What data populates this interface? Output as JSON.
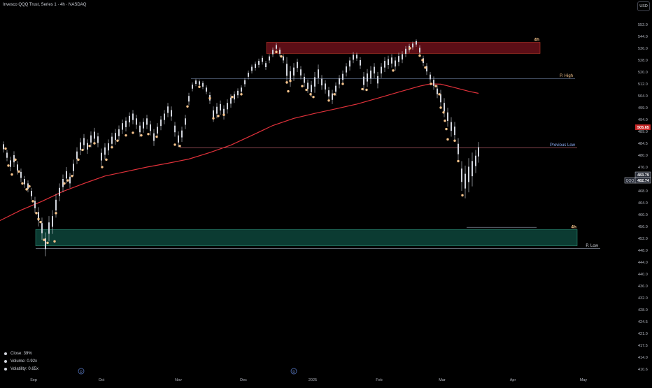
{
  "header": {
    "title": "Invesco QQQ Trust, Series 1 · 4h · NASDAQ",
    "currency": "USD"
  },
  "stats": [
    {
      "label": "Close: 39%"
    },
    {
      "label": "Volume: 0.92x"
    },
    {
      "label": "Volatility: 0.65x"
    }
  ],
  "colors": {
    "background": "#000000",
    "candle": "#d1d4dc",
    "ma_line": "#e0313a",
    "marker": "#f7c48c",
    "resistance_zone": "#5c0e16",
    "support_zone": "#0b3b32",
    "level_line": "#5b6b8a",
    "axis_text": "#b2b5be"
  },
  "chart_data": {
    "type": "candlestick",
    "symbol": "QQQ",
    "price_axis": {
      "ticks": [
        410.6,
        414.0,
        417.5,
        421.0,
        424.5,
        428.0,
        432.0,
        436.0,
        440.0,
        444.0,
        448.0,
        452.0,
        456.0,
        460.0,
        464.0,
        468.0,
        472.0,
        476.0,
        480.0,
        484.5,
        489.0,
        494.0,
        499.0,
        504.0,
        512.0,
        520.0,
        528.0,
        536.0,
        544.0,
        552.0
      ],
      "scale": "log"
    },
    "time_axis": {
      "labels": [
        "Sep",
        "Oct",
        "Nov",
        "Dec",
        "2025",
        "Feb",
        "Mar",
        "Apr",
        "May"
      ]
    },
    "event_markers": [
      "D",
      "D"
    ],
    "price_tags": [
      {
        "label": "505.65",
        "value": 505.65,
        "color": "#e0313a"
      },
      {
        "label": "483.79",
        "value": 483.79,
        "color": "#d1d4dc"
      },
      {
        "label": "482.74",
        "value": 482.74,
        "color": "#d1d4dc",
        "prefix": "QQQ"
      }
    ],
    "levels": [
      {
        "label": "P. High",
        "value": 515.5
      },
      {
        "label": "Previous Low",
        "value": 482.8
      },
      {
        "label": "P. Low",
        "value": 448.6
      }
    ],
    "zones": [
      {
        "label": "4h",
        "kind": "resistance",
        "top": 540.0,
        "bottom": 532.5
      },
      {
        "label": "4h",
        "kind": "support",
        "top": 455.0,
        "bottom": 449.5
      }
    ],
    "ma_series": [
      [
        0,
        458.0
      ],
      [
        30,
        461.5
      ],
      [
        60,
        464.5
      ],
      [
        90,
        467.8
      ],
      [
        120,
        470.5
      ],
      [
        150,
        473.0
      ],
      [
        180,
        474.5
      ],
      [
        210,
        476.0
      ],
      [
        240,
        477.3
      ],
      [
        270,
        478.7
      ],
      [
        300,
        481.0
      ],
      [
        330,
        483.8
      ],
      [
        360,
        487.5
      ],
      [
        390,
        491.5
      ],
      [
        420,
        494.5
      ],
      [
        450,
        496.6
      ],
      [
        480,
        498.5
      ],
      [
        510,
        500.5
      ],
      [
        540,
        503.0
      ],
      [
        570,
        506.5
      ],
      [
        600,
        510.5
      ],
      [
        615,
        512.0
      ],
      [
        630,
        511.8
      ],
      [
        650,
        509.5
      ],
      [
        670,
        507.0
      ],
      [
        684,
        505.65
      ]
    ],
    "candles": [
      [
        5,
        481.0,
        485.2
      ],
      [
        10,
        478.0,
        482.0
      ],
      [
        15,
        474.6,
        479.5
      ],
      [
        20,
        476.0,
        481.5
      ],
      [
        25,
        473.5,
        478.0
      ],
      [
        30,
        471.0,
        475.5
      ],
      [
        35,
        469.0,
        473.0
      ],
      [
        40,
        467.5,
        471.5
      ],
      [
        45,
        465.0,
        469.0
      ],
      [
        50,
        460.5,
        466.0
      ],
      [
        55,
        456.0,
        462.5
      ],
      [
        60,
        451.5,
        459.0
      ],
      [
        65,
        446.0,
        454.0
      ],
      [
        70,
        451.0,
        459.5
      ],
      [
        75,
        453.5,
        461.5
      ],
      [
        80,
        459.0,
        467.0
      ],
      [
        85,
        464.5,
        470.5
      ],
      [
        90,
        467.5,
        473.5
      ],
      [
        95,
        470.5,
        476.0
      ],
      [
        100,
        469.0,
        474.0
      ],
      [
        105,
        473.0,
        478.5
      ],
      [
        110,
        477.0,
        483.0
      ],
      [
        115,
        480.0,
        486.5
      ],
      [
        120,
        482.0,
        488.0
      ],
      [
        125,
        480.5,
        486.0
      ],
      [
        130,
        483.0,
        489.0
      ],
      [
        135,
        484.5,
        490.5
      ],
      [
        140,
        483.0,
        488.5
      ],
      [
        145,
        476.5,
        482.5
      ],
      [
        150,
        478.5,
        484.5
      ],
      [
        155,
        480.0,
        486.0
      ],
      [
        160,
        482.5,
        488.5
      ],
      [
        165,
        484.0,
        490.0
      ],
      [
        170,
        485.5,
        491.5
      ],
      [
        175,
        488.0,
        494.0
      ],
      [
        180,
        489.0,
        495.0
      ],
      [
        185,
        491.0,
        497.0
      ],
      [
        190,
        492.0,
        498.0
      ],
      [
        195,
        490.0,
        496.0
      ],
      [
        200,
        487.0,
        493.0
      ],
      [
        205,
        488.5,
        494.5
      ],
      [
        210,
        490.0,
        496.0
      ],
      [
        215,
        487.5,
        493.5
      ],
      [
        220,
        483.5,
        490.0
      ],
      [
        225,
        486.5,
        492.5
      ],
      [
        230,
        489.5,
        495.5
      ],
      [
        235,
        492.0,
        498.0
      ],
      [
        240,
        495.0,
        501.0
      ],
      [
        245,
        493.5,
        499.5
      ],
      [
        250,
        487.0,
        493.0
      ],
      [
        255,
        483.0,
        489.0
      ],
      [
        260,
        485.0,
        491.0
      ],
      [
        265,
        490.0,
        496.0
      ],
      [
        270,
        500.0,
        506.0
      ],
      [
        275,
        507.0,
        513.0
      ],
      [
        280,
        510.5,
        515.5
      ],
      [
        285,
        510.0,
        515.0
      ],
      [
        290,
        508.5,
        514.0
      ],
      [
        295,
        505.0,
        511.0
      ],
      [
        300,
        500.5,
        506.5
      ],
      [
        305,
        493.0,
        499.5
      ],
      [
        310,
        494.5,
        501.0
      ],
      [
        315,
        496.0,
        502.0
      ],
      [
        320,
        494.0,
        500.0
      ],
      [
        325,
        496.5,
        502.5
      ],
      [
        330,
        499.0,
        505.0
      ],
      [
        335,
        501.0,
        507.0
      ],
      [
        340,
        503.0,
        509.0
      ],
      [
        345,
        505.0,
        511.0
      ],
      [
        350,
        510.0,
        516.0
      ],
      [
        355,
        515.0,
        521.0
      ],
      [
        360,
        519.0,
        525.0
      ],
      [
        365,
        521.0,
        527.0
      ],
      [
        370,
        523.0,
        529.0
      ],
      [
        375,
        525.0,
        531.0
      ],
      [
        380,
        521.5,
        527.5
      ],
      [
        385,
        526.0,
        532.0
      ],
      [
        390,
        530.0,
        536.5
      ],
      [
        395,
        534.0,
        539.5
      ],
      [
        400,
        530.5,
        536.5
      ],
      [
        405,
        526.0,
        532.0
      ],
      [
        410,
        512.0,
        530.0
      ],
      [
        415,
        510.0,
        524.0
      ],
      [
        420,
        514.0,
        526.0
      ],
      [
        425,
        520.0,
        529.0
      ],
      [
        430,
        515.0,
        524.0
      ],
      [
        435,
        510.0,
        519.0
      ],
      [
        440,
        506.0,
        515.0
      ],
      [
        445,
        503.5,
        514.0
      ],
      [
        450,
        506.0,
        520.0
      ],
      [
        455,
        512.0,
        525.0
      ],
      [
        460,
        508.0,
        518.0
      ],
      [
        465,
        505.5,
        514.5
      ],
      [
        470,
        502.0,
        510.0
      ],
      [
        475,
        500.5,
        508.0
      ],
      [
        480,
        504.0,
        513.0
      ],
      [
        485,
        509.0,
        518.0
      ],
      [
        490,
        512.0,
        521.0
      ],
      [
        495,
        517.0,
        526.0
      ],
      [
        500,
        521.0,
        530.0
      ],
      [
        505,
        526.0,
        533.5
      ],
      [
        510,
        527.5,
        533.0
      ],
      [
        515,
        522.0,
        530.0
      ],
      [
        520,
        507.5,
        520.0
      ],
      [
        525,
        510.0,
        522.0
      ],
      [
        530,
        512.0,
        524.0
      ],
      [
        535,
        516.0,
        526.0
      ],
      [
        540,
        509.0,
        520.0
      ],
      [
        545,
        516.0,
        526.0
      ],
      [
        550,
        520.0,
        530.0
      ],
      [
        555,
        522.0,
        531.0
      ],
      [
        560,
        523.0,
        532.0
      ],
      [
        565,
        521.0,
        530.0
      ],
      [
        570,
        524.0,
        533.0
      ],
      [
        575,
        526.0,
        534.0
      ],
      [
        580,
        530.0,
        537.5
      ],
      [
        585,
        533.0,
        539.0
      ],
      [
        590,
        535.0,
        540.5
      ],
      [
        595,
        537.0,
        542.0
      ],
      [
        600,
        531.0,
        538.0
      ],
      [
        605,
        524.0,
        531.0
      ],
      [
        610,
        518.0,
        526.0
      ],
      [
        615,
        513.0,
        520.0
      ],
      [
        620,
        508.0,
        517.0
      ],
      [
        625,
        503.0,
        511.0
      ],
      [
        630,
        499.0,
        508.0
      ],
      [
        635,
        495.0,
        503.0
      ],
      [
        640,
        491.0,
        499.0
      ],
      [
        645,
        487.0,
        495.0
      ],
      [
        650,
        485.5,
        493.0
      ],
      [
        655,
        478.0,
        486.5
      ],
      [
        660,
        468.0,
        478.0
      ],
      [
        665,
        465.5,
        476.5
      ],
      [
        670,
        467.5,
        479.0
      ],
      [
        675,
        469.5,
        481.0
      ],
      [
        680,
        474.0,
        482.0
      ],
      [
        684,
        477.5,
        485.0
      ]
    ],
    "markers": [
      [
        8,
        482.5
      ],
      [
        12,
        476.5
      ],
      [
        17,
        473.5
      ],
      [
        22,
        478.5
      ],
      [
        27,
        474.5
      ],
      [
        32,
        470.5
      ],
      [
        38,
        468.5
      ],
      [
        42,
        469.5
      ],
      [
        47,
        464.5
      ],
      [
        52,
        460.5
      ],
      [
        55,
        458.5
      ],
      [
        58,
        457.5
      ],
      [
        63,
        451.5
      ],
      [
        68,
        450.5
      ],
      [
        78,
        451.0
      ],
      [
        80,
        460.5
      ],
      [
        92,
        470.5
      ],
      [
        97,
        471.5
      ],
      [
        103,
        473.0
      ],
      [
        112,
        478.5
      ],
      [
        118,
        482.0
      ],
      [
        128,
        483.5
      ],
      [
        135,
        484.5
      ],
      [
        146,
        476.0
      ],
      [
        152,
        478.5
      ],
      [
        160,
        483.0
      ],
      [
        168,
        485.5
      ],
      [
        180,
        487.5
      ],
      [
        190,
        488.5
      ],
      [
        202,
        487.5
      ],
      [
        212,
        488.0
      ],
      [
        224,
        487.0
      ],
      [
        250,
        484.0
      ],
      [
        257,
        483.5
      ],
      [
        268,
        499.5
      ],
      [
        285,
        510.0
      ],
      [
        300,
        503.0
      ],
      [
        305,
        494.5
      ],
      [
        312,
        495.5
      ],
      [
        320,
        496.0
      ],
      [
        332,
        503.5
      ],
      [
        345,
        505.0
      ],
      [
        395,
        533.5
      ],
      [
        402,
        530.5
      ],
      [
        410,
        513.0
      ],
      [
        415,
        514.0
      ],
      [
        412,
        507.0
      ],
      [
        432,
        510.5
      ],
      [
        438,
        508.0
      ],
      [
        444,
        505.0
      ],
      [
        448,
        503.5
      ],
      [
        470,
        502.0
      ],
      [
        478,
        505.0
      ],
      [
        490,
        512.0
      ],
      [
        518,
        508.5
      ],
      [
        524,
        508.0
      ],
      [
        562,
        521.0
      ],
      [
        586,
        536.0
      ],
      [
        600,
        531.0
      ],
      [
        604,
        528.0
      ],
      [
        608,
        523.0
      ],
      [
        616,
        512.0
      ],
      [
        623,
        510.5
      ],
      [
        628,
        505.0
      ],
      [
        630,
        499.0
      ],
      [
        634,
        497.0
      ],
      [
        636,
        493.5
      ],
      [
        638,
        490.0
      ],
      [
        640,
        486.0
      ],
      [
        650,
        485.5
      ],
      [
        655,
        478.0
      ],
      [
        661,
        466.5
      ]
    ]
  }
}
